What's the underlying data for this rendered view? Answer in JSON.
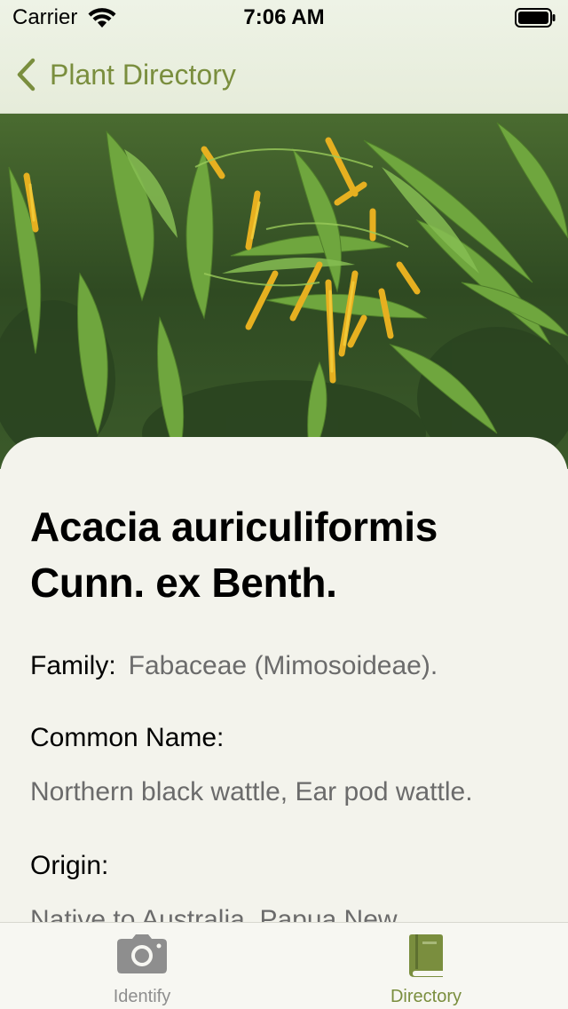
{
  "status_bar": {
    "carrier": "Carrier",
    "time": "7:06 AM"
  },
  "nav": {
    "back_label": "Plant Directory",
    "accent_color": "#7a8e3e"
  },
  "plant": {
    "name": "Acacia auriculiformis Cunn. ex Benth.",
    "family_label": "Family:",
    "family_value": "Fabaceae (Mimosoideae).",
    "common_name_label": "Common Name:",
    "common_name_value": "Northern black wattle, Ear pod wattle.",
    "origin_label": "Origin:",
    "origin_value": "Native to Australia, Papua New"
  },
  "tabs": [
    {
      "label": "Identify",
      "icon": "camera-icon",
      "selected": false
    },
    {
      "label": "Directory",
      "icon": "book-icon",
      "selected": true
    }
  ]
}
